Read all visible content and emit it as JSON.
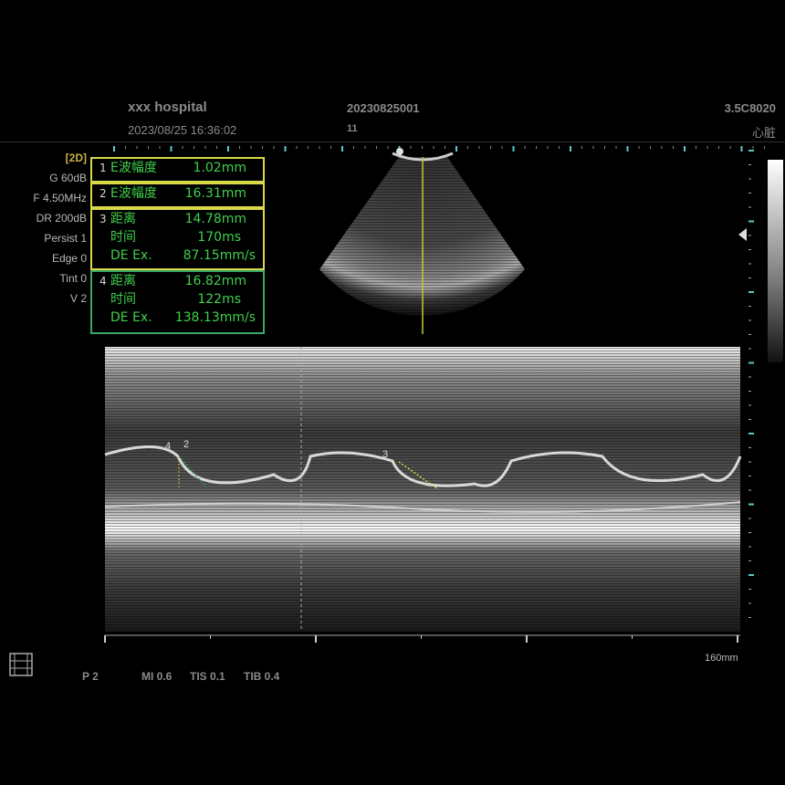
{
  "header": {
    "hospital": "xxx hospital",
    "datetime": "2023/08/25 16:36:02",
    "patient_id": "20230825001",
    "patient_num": "11",
    "probe": "3.5C8020",
    "preset": "心脏"
  },
  "params": {
    "mode": "[2D]",
    "gain": "G 60dB",
    "freq": "F 4.50MHz",
    "dr": "DR 200dB",
    "persist": "Persist 1",
    "edge": "Edge 0",
    "tint": "Tint 0",
    "v": "V 2"
  },
  "measurements": [
    {
      "num": "1",
      "rows": [
        {
          "label": "E波幅度",
          "value": "1.02mm"
        }
      ]
    },
    {
      "num": "2",
      "rows": [
        {
          "label": "E波幅度",
          "value": "16.31mm"
        }
      ]
    },
    {
      "num": "3",
      "rows": [
        {
          "label": "距离",
          "value": "14.78mm"
        },
        {
          "label": "时间",
          "value": "170ms"
        },
        {
          "label": "DE Ex.",
          "value": "87.15mm/s"
        }
      ]
    },
    {
      "num": "4",
      "rows": [
        {
          "label": "距离",
          "value": "16.82mm"
        },
        {
          "label": "时间",
          "value": "122ms"
        },
        {
          "label": "DE Ex.",
          "value": "138.13mm/s"
        }
      ]
    }
  ],
  "mmode": {
    "depth_label": "160mm",
    "caliper_labels": [
      "4",
      "2",
      "3"
    ]
  },
  "footer": {
    "p": "P 2",
    "mi": "MI 0.6",
    "tis": "TIS 0.1",
    "tib": "TIB 0.4"
  },
  "icons": {
    "cine": "film-icon"
  },
  "colors": {
    "yellow_box": "#d9d94a",
    "green_box": "#3aa86a",
    "meas_text": "#3fd04c",
    "cursor_line": "#c8c82a"
  }
}
